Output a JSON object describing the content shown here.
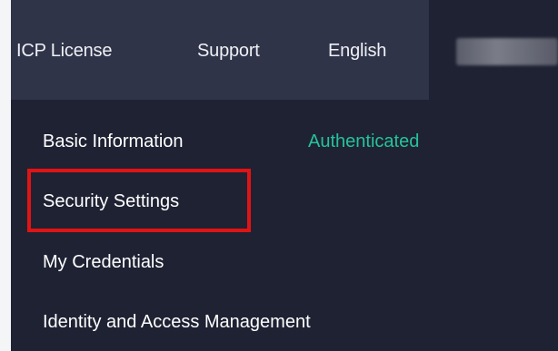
{
  "topbar": {
    "items": [
      {
        "label": "ICP License"
      },
      {
        "label": "Support"
      },
      {
        "label": "English"
      }
    ]
  },
  "account_menu": {
    "items": [
      {
        "label": "Basic Information",
        "status": "Authenticated",
        "status_color": "#25c29b"
      },
      {
        "label": "Security Settings",
        "highlighted": true
      },
      {
        "label": "My Credentials"
      },
      {
        "label": "Identity and Access Management"
      }
    ]
  },
  "colors": {
    "panel_bg": "#1f2233",
    "topbar_active_bg": "#2f3449",
    "highlight_border": "#e01414"
  }
}
